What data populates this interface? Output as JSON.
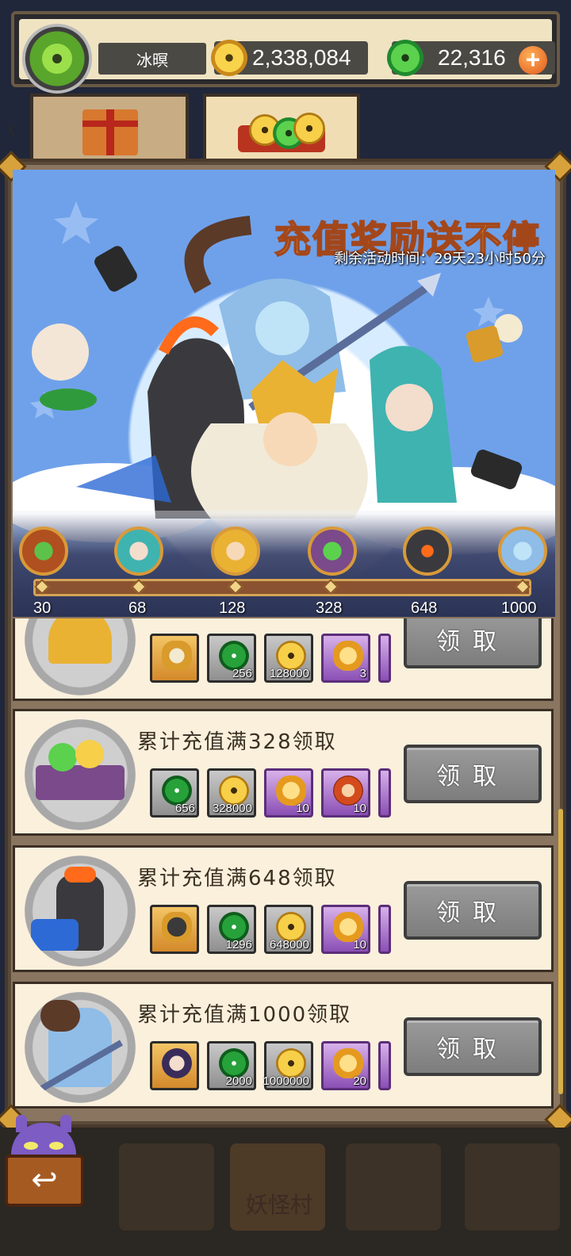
{
  "header": {
    "player_name": "冰暝",
    "gold": "2,338,084",
    "jade": "22,316",
    "plus_label": "+"
  },
  "tabs": [
    {
      "name": "gift-box",
      "selected": false
    },
    {
      "name": "recharge-coins",
      "selected": true
    }
  ],
  "banner": {
    "title": "充值奖励送不停",
    "timer": "剩余活动时间：29天23小时50分"
  },
  "milestones": [
    "30",
    "68",
    "128",
    "328",
    "648",
    "1000"
  ],
  "rows": [
    {
      "title": "",
      "items": [
        {
          "type": "orange",
          "icon": "chess-piece",
          "qty": ""
        },
        {
          "type": "grey",
          "icon": "jade",
          "qty": "256"
        },
        {
          "type": "grey",
          "icon": "goldcoin",
          "qty": "128000"
        },
        {
          "type": "purple",
          "icon": "beetle",
          "qty": "3"
        }
      ],
      "button": "领取"
    },
    {
      "title": "累计充值满328领取",
      "items": [
        {
          "type": "grey",
          "icon": "jade",
          "qty": "656"
        },
        {
          "type": "grey",
          "icon": "goldcoin",
          "qty": "328000"
        },
        {
          "type": "purple",
          "icon": "beetle",
          "qty": "10"
        },
        {
          "type": "purple",
          "icon": "redorb",
          "qty": "10"
        }
      ],
      "button": "领取"
    },
    {
      "title": "累计充值满648领取",
      "items": [
        {
          "type": "orange",
          "icon": "chess-piece",
          "qty": ""
        },
        {
          "type": "grey",
          "icon": "jade",
          "qty": "1296"
        },
        {
          "type": "grey",
          "icon": "goldcoin",
          "qty": "648000"
        },
        {
          "type": "purple",
          "icon": "beetle",
          "qty": "10"
        }
      ],
      "button": "领取"
    },
    {
      "title": "累计充值满1000领取",
      "items": [
        {
          "type": "orange",
          "icon": "hero-card",
          "qty": ""
        },
        {
          "type": "grey",
          "icon": "jade",
          "qty": "2000"
        },
        {
          "type": "grey",
          "icon": "goldcoin",
          "qty": "1000000"
        },
        {
          "type": "purple",
          "icon": "beetle",
          "qty": "20"
        }
      ],
      "button": "领取"
    }
  ],
  "bottom_nav": {
    "village_label": "妖怪村"
  },
  "colors": {
    "gold": "#f9d34b",
    "jade": "#27a13a",
    "claim_button": "#8c8c8c",
    "row_bg": "#fbf0dc"
  }
}
